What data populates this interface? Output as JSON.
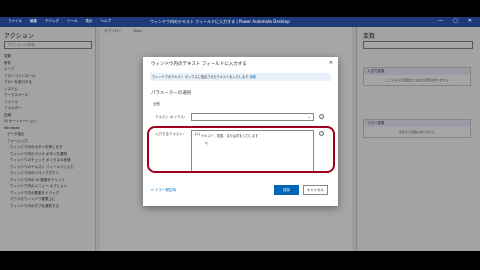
{
  "window": {
    "title": "ウィンドウ内のテキスト フィールドに入力する | Power Automate Desktop",
    "menu": [
      "ファイル",
      "編集",
      "デバッグ",
      "ツール",
      "表示",
      "ヘルプ"
    ],
    "controls": [
      "—",
      "▢",
      "✕"
    ]
  },
  "left_panel": {
    "title": "アクション",
    "search_placeholder": "アクションの検索",
    "items": [
      "変数",
      "条件",
      "ループ",
      "フローコントロール",
      "フローを実行する",
      "システム",
      "ワークスペース",
      "ファイル",
      "フォルダー",
      "圧縮",
      "UI オートメーション",
      "Windows",
      "データ抽出",
      "フォーム入力",
      "ウィンドウ内のボタンを押します",
      "ウィンドウ内のラジオ ボタンを選択",
      "ウィンドウのチェック ボックスの状態",
      "ウィンドウのテキスト フィールドに入力",
      "ウィンドウ内のドロップダウン",
      "ウィンドウ内の UI 要素をクリック",
      "ウィンドウ内のメニュー オプション",
      "ウィンドウ内の要素をドラッグ",
      "マウスをウィンドウ要素上に",
      "ウィンドウ内のタブを選択する"
    ]
  },
  "middle": {
    "toolbar": [
      "サブフロー",
      "Main"
    ]
  },
  "right_panel": {
    "title": "変数",
    "input_output_label": "入出力変数",
    "input_output_empty": "ここには入力変数または出力変数はありません",
    "flow_vars_label": "フロー変数",
    "flow_vars_empty": "表示する変数はありません"
  },
  "dialog": {
    "title": "ウィンドウ内のテキスト フィールドに入力する",
    "close": "✕",
    "info_text": "ウィンドウのテキスト ボックスに指定されたテキストを入力します ",
    "info_link": "詳細",
    "params_heading": "パラメーターの選択",
    "general_heading": "全般",
    "textbox_label": "テキスト ボックス:",
    "text_label": "入力するテキスト:",
    "text_value": "テキスト、変数、または式を入力します",
    "help_icon": "ⓘ",
    "var_icon": "{x}",
    "on_error_label": "エラー発生時",
    "save_label": "保存",
    "cancel_label": "キャンセル"
  },
  "colors": {
    "accent": "#0067b8",
    "highlight": "#a0001f",
    "titlebar": "#1f3a7a"
  }
}
